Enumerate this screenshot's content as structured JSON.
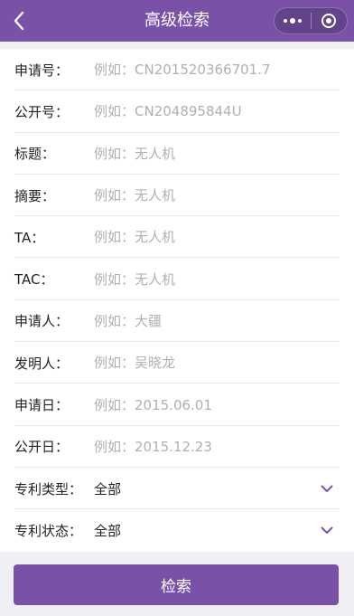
{
  "header": {
    "title": "高级检索"
  },
  "fields": [
    {
      "label": "申请号：",
      "placeholder": "例如：CN201520366701.7"
    },
    {
      "label": "公开号：",
      "placeholder": "例如：CN204895844U"
    },
    {
      "label": "标题：",
      "placeholder": "例如：无人机"
    },
    {
      "label": "摘要：",
      "placeholder": "例如：无人机"
    },
    {
      "label": "TA：",
      "placeholder": "例如：无人机"
    },
    {
      "label": "TAC：",
      "placeholder": "例如：无人机"
    },
    {
      "label": "申请人：",
      "placeholder": "例如：大疆"
    },
    {
      "label": "发明人：",
      "placeholder": "例如：吴晓龙"
    },
    {
      "label": "申请日：",
      "placeholder": "例如：2015.06.01"
    },
    {
      "label": "公开日：",
      "placeholder": "例如：2015.12.23"
    }
  ],
  "selects": [
    {
      "label": "专利类型：",
      "value": "全部"
    },
    {
      "label": "专利状态：",
      "value": "全部"
    }
  ],
  "search_button": "检索",
  "colors": {
    "accent": "#7952a8"
  }
}
